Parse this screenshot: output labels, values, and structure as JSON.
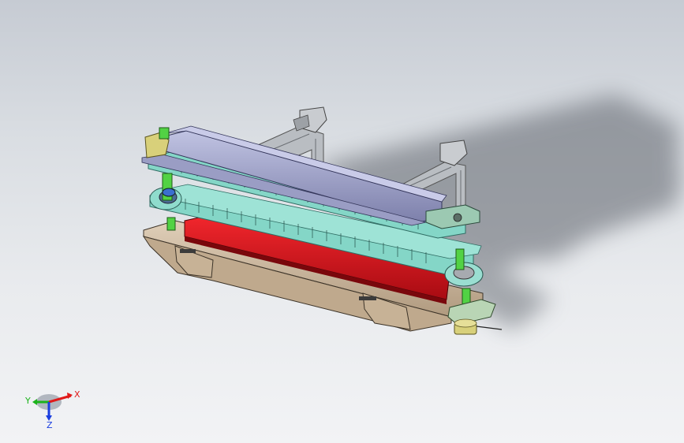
{
  "viewport": {
    "background": "#dde0e5",
    "shadow_color": "#7b8089"
  },
  "model": {
    "colors": {
      "top_rail": "#9c9fc6",
      "top_rail_dark": "#6c6f98",
      "chain_links": "#7fd3c4",
      "chain_dark": "#3d8f84",
      "red_plate": "#e0121a",
      "red_dark": "#9a0a10",
      "base_plate": "#cdb79c",
      "base_dark": "#8e7a62",
      "green_post": "#4fcf3f",
      "yellow_part": "#d8d07a",
      "frame_gray": "#b8bcc0"
    }
  },
  "triad": {
    "x_label": "X",
    "y_label": "Y",
    "z_label": "Z",
    "x_color": "#e01a1a",
    "y_color": "#1bb31b",
    "z_color": "#1a3ee0"
  }
}
